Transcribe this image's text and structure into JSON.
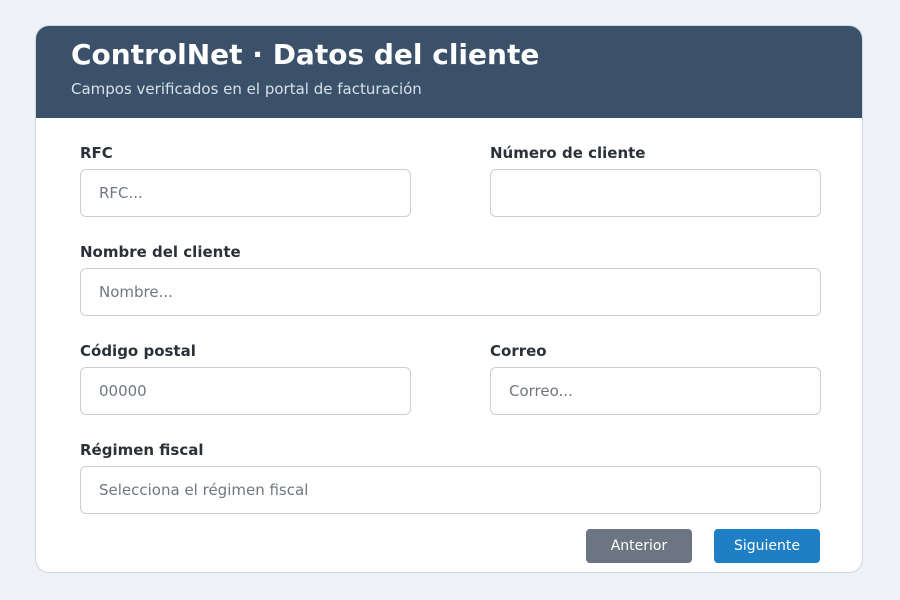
{
  "header": {
    "title": "ControlNet · Datos del cliente",
    "subtitle": "Campos verificados en el portal de facturación"
  },
  "form": {
    "rfc": {
      "label": "RFC",
      "placeholder": "RFC...",
      "value": ""
    },
    "numero_cliente": {
      "label": "Número de cliente",
      "placeholder": "",
      "value": ""
    },
    "nombre_cliente": {
      "label": "Nombre del cliente",
      "placeholder": "Nombre...",
      "value": ""
    },
    "codigo_postal": {
      "label": "Código postal",
      "placeholder": "00000",
      "value": ""
    },
    "correo": {
      "label": "Correo",
      "placeholder": "Correo...",
      "value": ""
    },
    "regimen_fiscal": {
      "label": "Régimen fiscal",
      "selected": "Selecciona el régimen fiscal"
    }
  },
  "actions": {
    "previous_label": "Anterior",
    "next_label": "Siguiente"
  },
  "colors": {
    "header_bg": "#3b5169",
    "next_button": "#1f7fc4",
    "previous_button": "#6b7682"
  }
}
